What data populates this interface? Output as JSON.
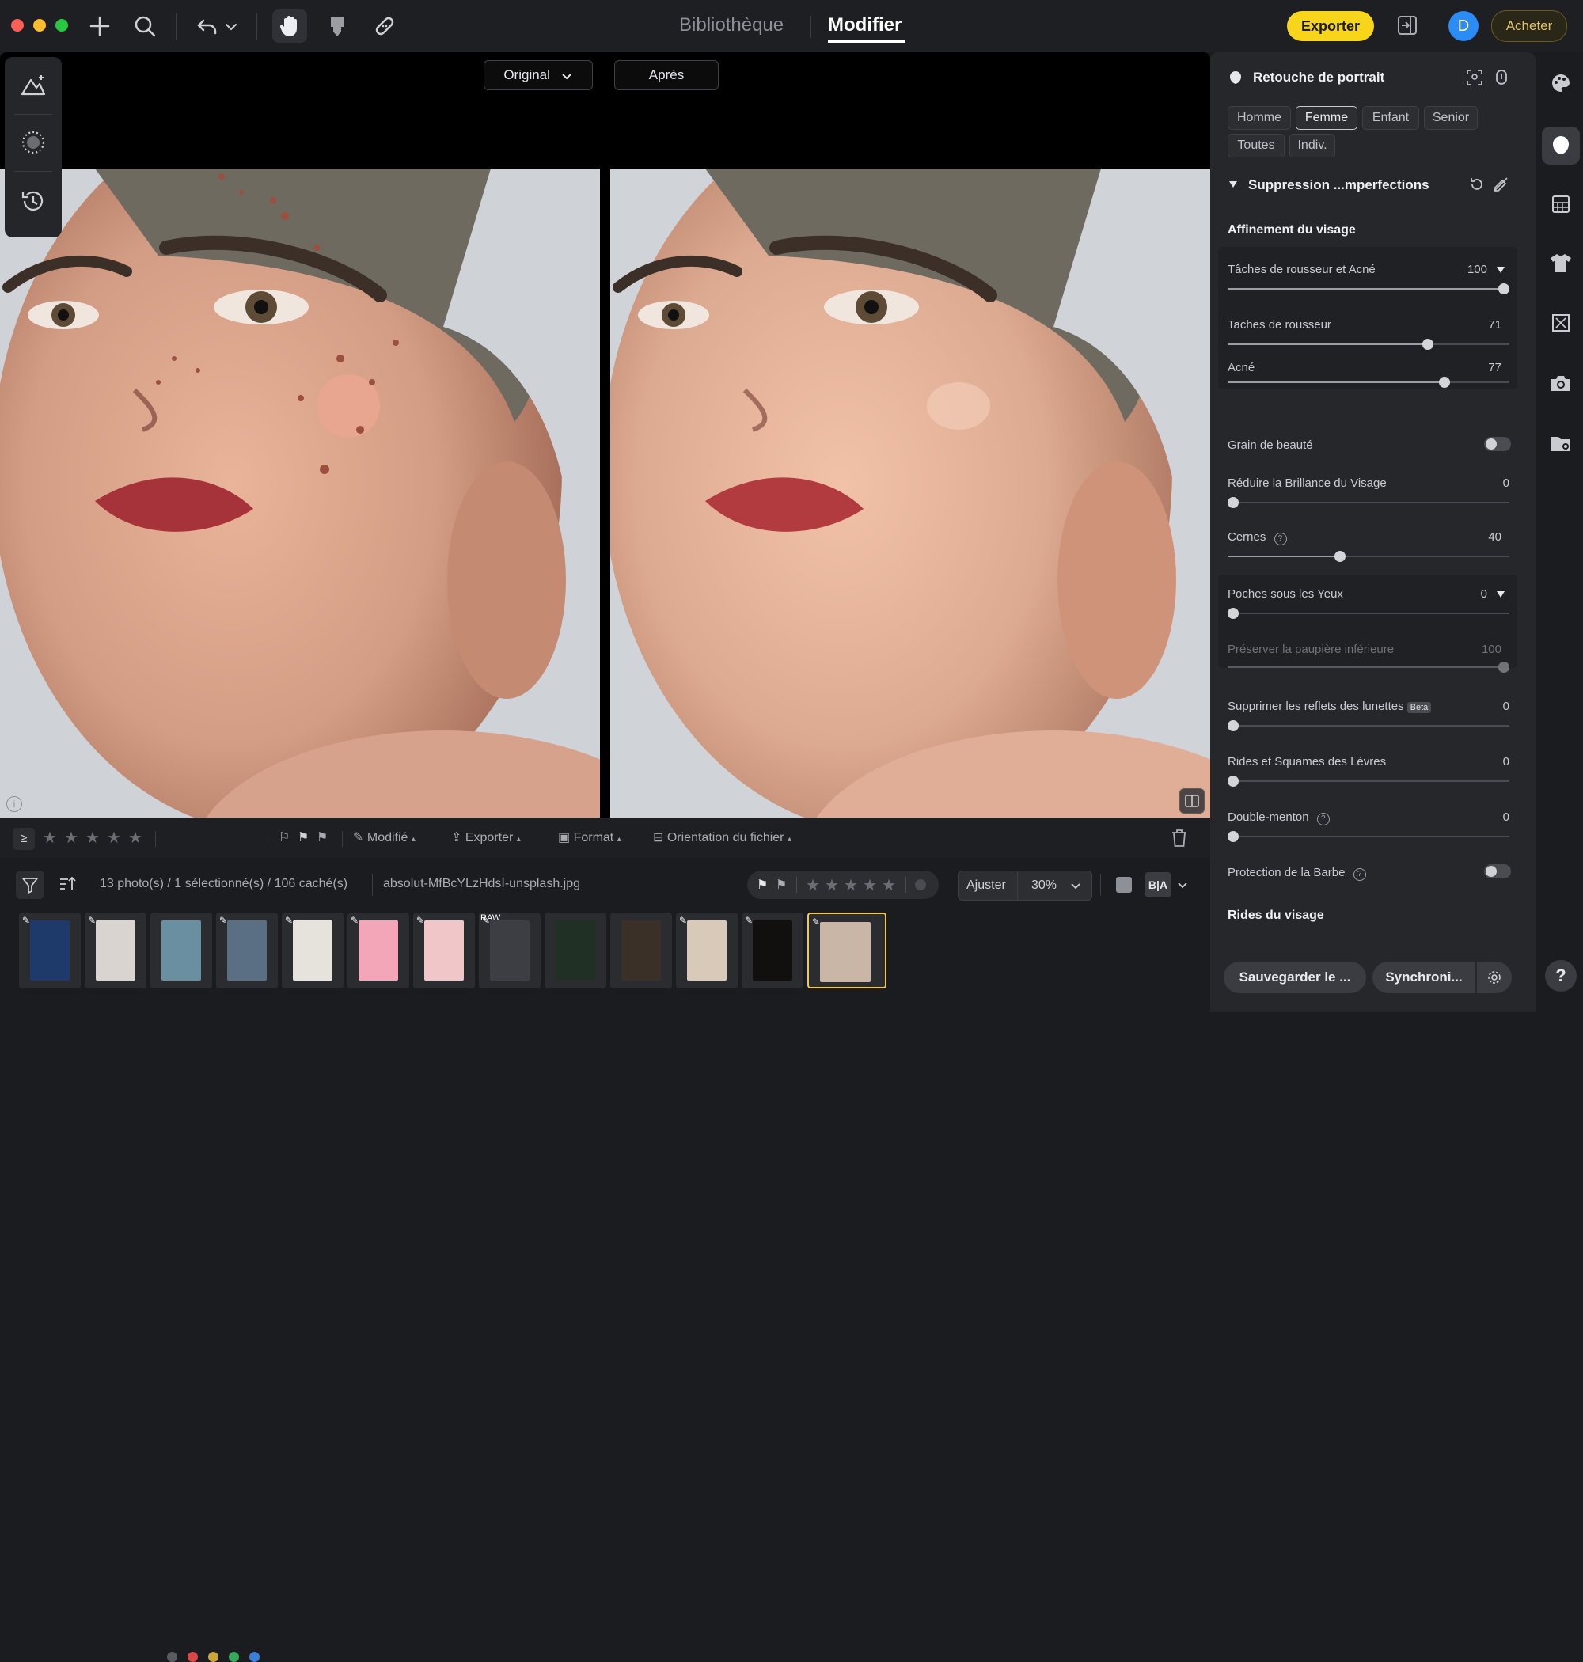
{
  "topbar": {
    "tab_library": "Bibliothèque",
    "tab_modify": "Modifier",
    "export_label": "Exporter",
    "avatar_letter": "D",
    "buy_label": "Acheter"
  },
  "compare": {
    "original_label": "Original",
    "after_label": "Après"
  },
  "infobar": {
    "modified_label": "Modifié",
    "export_label": "Exporter",
    "format_label": "Format",
    "orientation_label": "Orientation du fichier",
    "color_labels": [
      "#5a5c61",
      "#d94848",
      "#c9a53a",
      "#3aa85a",
      "#3b7fd9"
    ]
  },
  "filterbar": {
    "count_text": "13 photo(s) / 1 sélectionné(s) / 106 caché(s)",
    "filename": "absolut-MfBcYLzHdsI-unsplash.jpg",
    "fit_label": "Ajuster",
    "zoom_label": "30%"
  },
  "filmstrip": {
    "raw_badge": "RAW",
    "thumb_colors": [
      "#1d3a6b",
      "#d9d4cf",
      "#6a8fa0",
      "#5b6f84",
      "#e6e2dc",
      "#f2a6b8",
      "#f0c6c8",
      "#3c3e44",
      "#203024",
      "#3b3028",
      "#d8c9b8",
      "#12100f",
      "#c9b6a7"
    ]
  },
  "panel": {
    "title": "Retouche de portrait",
    "chips": [
      "Homme",
      "Femme",
      "Enfant",
      "Senior",
      "Toutes",
      "Indiv."
    ],
    "active_chip": "Femme",
    "section_title": "Suppression ...mperfections",
    "subsection_face": "Affinement du visage",
    "sliders": {
      "freckles_acne": {
        "label": "Tâches de rousseur et Acné",
        "value": "100",
        "level": 1.0
      },
      "freckles": {
        "label": "Taches de rousseur",
        "value": "71",
        "level": 0.71
      },
      "acne": {
        "label": "Acné",
        "value": "77",
        "level": 0.77
      },
      "beauty_mark": {
        "label": "Grain de beauté"
      },
      "shine": {
        "label": "Réduire la Brillance du Visage",
        "value": "0",
        "level": 0
      },
      "dark_circles": {
        "label": "Cernes",
        "value": "40",
        "level": 0.4
      },
      "eye_bags": {
        "label": "Poches sous les Yeux",
        "value": "0",
        "level": 0
      },
      "lower_lid": {
        "label": "Préserver la paupière inférieure",
        "value": "100",
        "level": 1.0
      },
      "glasses": {
        "label": "Supprimer les reflets des lunettes",
        "badge": "Beta",
        "value": "0",
        "level": 0
      },
      "lips": {
        "label": "Rides et Squames des Lèvres",
        "value": "0",
        "level": 0
      },
      "double_chin": {
        "label": "Double-menton",
        "value": "0",
        "level": 0
      },
      "beard": {
        "label": "Protection de la Barbe"
      }
    },
    "subsection_wrinkles": "Rides du visage",
    "save_label": "Sauvegarder le ...",
    "sync_label": "Synchroni..."
  },
  "rail": {
    "help_label": "?"
  }
}
